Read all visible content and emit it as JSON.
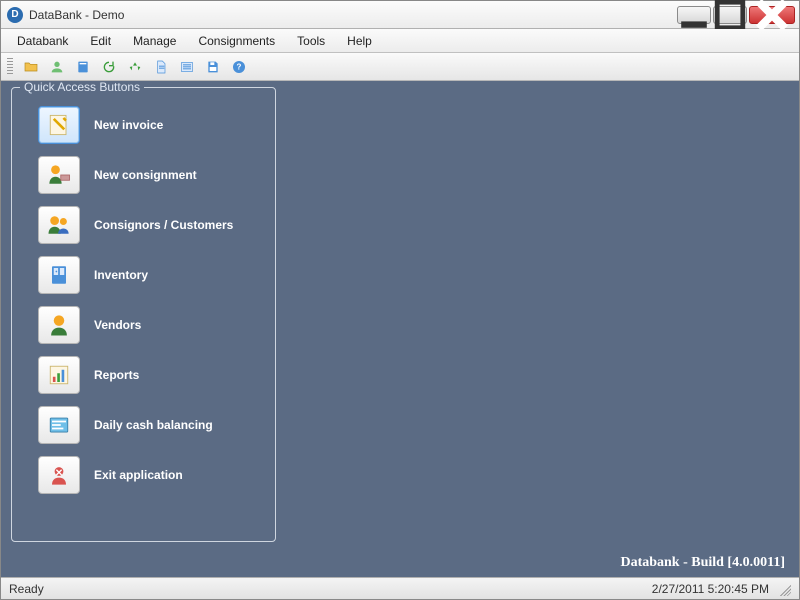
{
  "window": {
    "title": "DataBank - Demo"
  },
  "menubar": {
    "items": [
      {
        "label": "Databank"
      },
      {
        "label": "Edit"
      },
      {
        "label": "Manage"
      },
      {
        "label": "Consignments"
      },
      {
        "label": "Tools"
      },
      {
        "label": "Help"
      }
    ]
  },
  "toolbar": {
    "icons": [
      "folder-open-icon",
      "user-green-icon",
      "book-blue-icon",
      "arrow-refresh-icon",
      "recycle-icon",
      "document-blue-icon",
      "list-blue-icon",
      "save-diskette-icon",
      "help-question-icon"
    ]
  },
  "quick_access": {
    "title": "Quick Access Buttons",
    "items": [
      {
        "label": "New invoice",
        "icon": "new-invoice-icon",
        "selected": true
      },
      {
        "label": "New consignment",
        "icon": "new-consignment-icon",
        "selected": false
      },
      {
        "label": "Consignors / Customers",
        "icon": "consignors-icon",
        "selected": false
      },
      {
        "label": "Inventory",
        "icon": "inventory-icon",
        "selected": false
      },
      {
        "label": "Vendors",
        "icon": "vendors-icon",
        "selected": false
      },
      {
        "label": "Reports",
        "icon": "reports-icon",
        "selected": false
      },
      {
        "label": "Daily cash balancing",
        "icon": "cash-balancing-icon",
        "selected": false
      },
      {
        "label": "Exit application",
        "icon": "exit-app-icon",
        "selected": false
      }
    ]
  },
  "build_label": "Databank - Build [4.0.0011]",
  "statusbar": {
    "status": "Ready",
    "datetime": "2/27/2011 5:20:45 PM"
  },
  "colors": {
    "client_bg": "#5b6b84",
    "accent_blue": "#4a90d9"
  }
}
